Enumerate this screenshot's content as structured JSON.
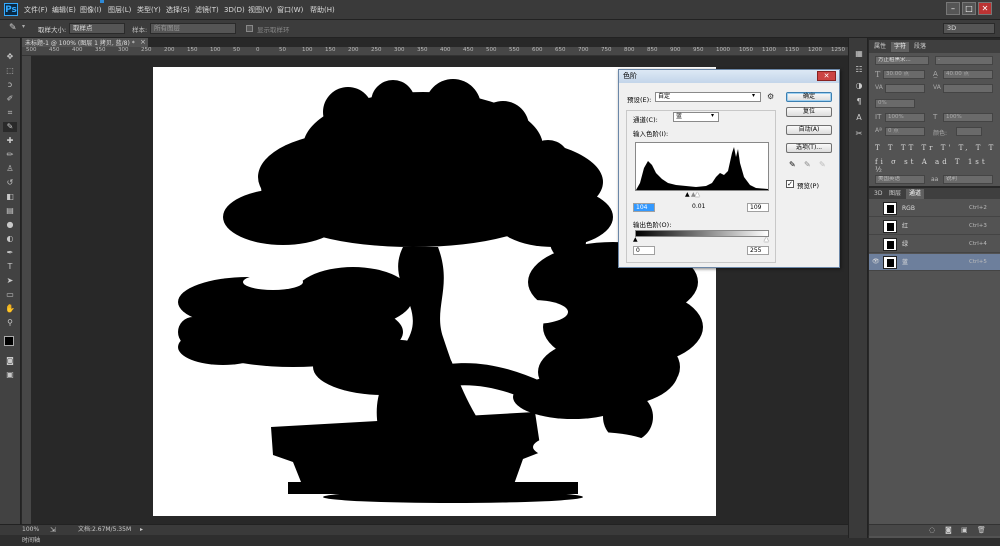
{
  "app": {
    "logo": "Ps"
  },
  "menu": [
    "文件(F)",
    "编辑(E)",
    "图像(I)",
    "图层(L)",
    "类型(Y)",
    "选择(S)",
    "滤镜(T)",
    "3D(D)",
    "视图(V)",
    "窗口(W)",
    "帮助(H)"
  ],
  "options": {
    "sample_size_label": "取样大小:",
    "sample_size_value": "取样点",
    "sample_label": "样本:",
    "sample_value": "所有图层",
    "show_ring_label": "显示取样环",
    "workspace": "3D"
  },
  "document": {
    "tab_title": "未标题-1 @ 100% (图层 1 拷贝, 蓝/8) *",
    "zoom": "100%",
    "doc_info": "文档:2.67M/5.35M",
    "bottom_label": "时间轴"
  },
  "ruler": [
    "500",
    "450",
    "400",
    "350",
    "300",
    "250",
    "200",
    "150",
    "100",
    "50",
    "0",
    "50",
    "100",
    "150",
    "200",
    "250",
    "300",
    "350",
    "400",
    "450",
    "500",
    "550",
    "600",
    "650",
    "700",
    "750",
    "800",
    "850",
    "900",
    "950",
    "1000",
    "1050",
    "1100",
    "1150",
    "1200",
    "1250"
  ],
  "levels_dialog": {
    "title": "色阶",
    "preset_label": "预设(E):",
    "preset_value": "自定",
    "channel_label": "通道(C):",
    "channel_value": "蓝",
    "input_label": "输入色阶(I):",
    "input_black": "104",
    "input_mid": "0.01",
    "input_white": "109",
    "output_label": "输出色阶(O):",
    "output_black": "0",
    "output_white": "255",
    "buttons": {
      "ok": "确定",
      "reset": "复位",
      "auto": "自动(A)",
      "options": "选项(T)..."
    },
    "preview_label": "预览(P)",
    "preview_checked": true
  },
  "right_panel": {
    "tabs": [
      "属性",
      "字符",
      "段落"
    ],
    "font_family": "方正粗黑宋...",
    "font_size": "30.00 点",
    "leading": "40.00 点",
    "tracking": "0%",
    "vertical_scale": "100%",
    "horizontal_scale": "100%",
    "baseline": "0 点",
    "color_label": "颜色:",
    "language": "美国英语",
    "antialias": "锐利",
    "aa_label": "aa",
    "text_styles": [
      "T",
      "T",
      "TT",
      "Tr",
      "T'",
      "T,",
      "T",
      "T"
    ],
    "open_type": [
      "fi",
      "σ",
      "st",
      "A",
      "ad",
      "T",
      "1st",
      "½"
    ]
  },
  "channels_panel": {
    "tabs": [
      "3D",
      "图层",
      "通道"
    ],
    "channels": [
      {
        "name": "RGB",
        "shortcut": "Ctrl+2",
        "visible": false,
        "active": false
      },
      {
        "name": "红",
        "shortcut": "Ctrl+3",
        "visible": false,
        "active": false
      },
      {
        "name": "绿",
        "shortcut": "Ctrl+4",
        "visible": false,
        "active": false
      },
      {
        "name": "蓝",
        "shortcut": "Ctrl+5",
        "visible": true,
        "active": true
      }
    ]
  },
  "colors": {
    "accent": "#2d8ad8",
    "panel": "#535353",
    "workspace": "#282828",
    "active_row": "#6d7f9c"
  }
}
